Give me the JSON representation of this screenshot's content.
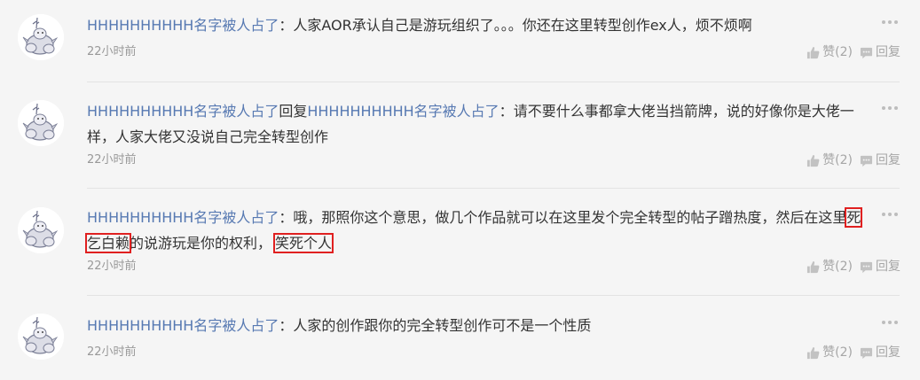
{
  "comments": [
    {
      "author": "HHHHHHHHHH名字被人占了",
      "colon": "：",
      "body": "人家AOR承认自己是游玩组织了。。。你还在这里转型创作ex人，烦不烦啊",
      "time": "22小时前",
      "like_label": "赞(2)",
      "reply_label": "回复"
    },
    {
      "author": "HHHHHHHHHH名字被人占了",
      "reply_word": "回复",
      "reply_to": "HHHHHHHHHH名字被人占了",
      "colon": "：",
      "body": "请不要什么事都拿大佬当挡箭牌，说的好像你是大佬一样，人家大佬又没说自己完全转型创作",
      "time": "22小时前",
      "like_label": "赞(2)",
      "reply_label": "回复"
    },
    {
      "author": "HHHHHHHHHH名字被人占了",
      "colon": "：",
      "body_part1": "哦，那照你这个意思，做几个作品就可以在这里发个完全转型的帖子蹭热度，然后在这里",
      "highlight1": "死乞白赖",
      "body_part2": "的说游玩是你的权利，",
      "highlight2": "笑死个人",
      "time": "22小时前",
      "like_label": "赞(2)",
      "reply_label": "回复"
    },
    {
      "author": "HHHHHHHHHH名字被人占了",
      "colon": "：",
      "body": "人家的创作跟你的完全转型创作可不是一个性质",
      "time": "22小时前",
      "like_label": "赞(2)",
      "reply_label": "回复"
    }
  ],
  "colors": {
    "author": "#5779b2",
    "highlight_border": "#e02020",
    "meta": "#999999",
    "background": "#f5f5f5"
  }
}
